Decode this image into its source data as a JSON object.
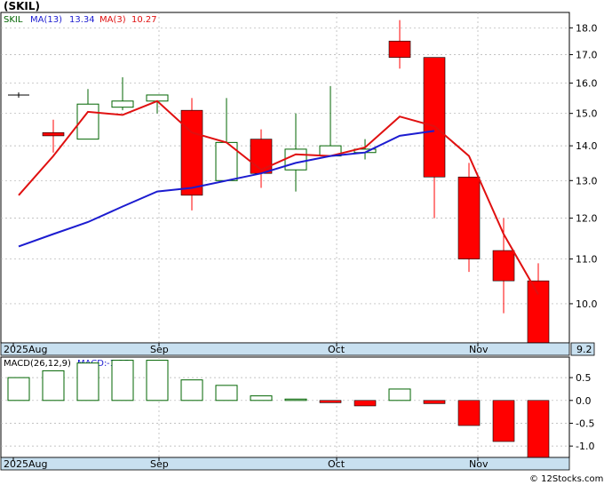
{
  "chart_title": "(SKIL)",
  "watermark": "© 12Stocks.com",
  "colors": {
    "up": "#006400",
    "down": "#ff0000",
    "ma13": "#1c1cd0",
    "ma3": "#e01010",
    "grid": "#b0b0b0",
    "axis_band": "#c8e0f0",
    "price_box": "#c8e0f0"
  },
  "price_panel": {
    "legend": [
      {
        "key": "symbol",
        "text": "SKIL",
        "color": "#006400"
      },
      {
        "key": "ma13",
        "text": "MA(13)",
        "value": "13.34",
        "color": "#1c1cd0"
      },
      {
        "key": "ma3",
        "text": "MA(3)",
        "value": "10.27",
        "color": "#e01010"
      }
    ],
    "last_price_label": "9.2",
    "y_ticks": [
      "10.0",
      "11.0",
      "12.0",
      "13.0",
      "14.0",
      "15.0",
      "16.0",
      "17.0",
      "18.0"
    ],
    "x_labels": [
      "2025Aug",
      "Sep",
      "Oct",
      "Nov"
    ]
  },
  "macd_panel": {
    "legend_main": "MACD(26,12,9)",
    "legend_value_label": "MACD:",
    "legend_value": "-1.25",
    "y_ticks": [
      "0.5",
      "0.0",
      "-0.5",
      "-1.0"
    ],
    "x_labels": [
      "2025Aug",
      "Sep",
      "Oct",
      "Nov"
    ]
  },
  "chart_data": [
    {
      "type": "candlestick",
      "title": "(SKIL)",
      "ylim": [
        9.2,
        18.6
      ],
      "y_scale": "log",
      "candles": [
        {
          "open": 15.6,
          "high": 15.6,
          "low": 15.6,
          "close": 15.6
        },
        {
          "open": 14.4,
          "high": 14.8,
          "low": 13.8,
          "close": 14.3
        },
        {
          "open": 14.2,
          "high": 15.8,
          "low": 14.2,
          "close": 15.3
        },
        {
          "open": 15.2,
          "high": 16.2,
          "low": 15.1,
          "close": 15.4
        },
        {
          "open": 15.4,
          "high": 15.6,
          "low": 15.0,
          "close": 15.6
        },
        {
          "open": 15.1,
          "high": 15.5,
          "low": 12.2,
          "close": 12.6
        },
        {
          "open": 13.0,
          "high": 15.5,
          "low": 13.0,
          "close": 14.1
        },
        {
          "open": 14.2,
          "high": 14.5,
          "low": 12.8,
          "close": 13.2
        },
        {
          "open": 13.3,
          "high": 15.0,
          "low": 12.7,
          "close": 13.9
        },
        {
          "open": 13.7,
          "high": 15.9,
          "low": 13.7,
          "close": 14.0
        },
        {
          "open": 13.8,
          "high": 14.2,
          "low": 13.6,
          "close": 13.9
        },
        {
          "open": 17.5,
          "high": 18.3,
          "low": 16.5,
          "close": 16.9
        },
        {
          "open": 16.9,
          "high": 16.9,
          "low": 12.0,
          "close": 13.1
        },
        {
          "open": 13.1,
          "high": 13.5,
          "low": 10.7,
          "close": 11.0
        },
        {
          "open": 11.2,
          "high": 12.0,
          "low": 9.8,
          "close": 10.5
        },
        {
          "open": 10.5,
          "high": 10.9,
          "low": 9.2,
          "close": 9.2
        }
      ],
      "ma13": [
        null,
        null,
        null,
        null,
        null,
        null,
        null,
        null,
        null,
        null,
        null,
        null,
        null,
        null,
        null,
        null
      ],
      "ma13_points": [
        {
          "i": 0,
          "v": 11.3
        },
        {
          "i": 2,
          "v": 11.6
        },
        {
          "i": 4,
          "v": 11.9
        },
        {
          "i": 6,
          "v": 12.3
        },
        {
          "i": 8,
          "v": 12.7
        },
        {
          "i": 10,
          "v": 12.8
        },
        {
          "i": 12,
          "v": 13.0
        },
        {
          "i": 14,
          "v": 13.2
        },
        {
          "i": 16,
          "v": 13.5
        },
        {
          "i": 18,
          "v": 13.7
        },
        {
          "i": 20,
          "v": 13.8
        },
        {
          "i": 22,
          "v": 14.3
        },
        {
          "i": 24,
          "v": 14.45
        }
      ],
      "ma3_points": [
        {
          "i": 0,
          "v": 12.6
        },
        {
          "i": 2,
          "v": 13.7
        },
        {
          "i": 4,
          "v": 15.05
        },
        {
          "i": 6,
          "v": 14.95
        },
        {
          "i": 8,
          "v": 15.4
        },
        {
          "i": 10,
          "v": 14.4
        },
        {
          "i": 12,
          "v": 14.1
        },
        {
          "i": 14,
          "v": 13.3
        },
        {
          "i": 16,
          "v": 13.75
        },
        {
          "i": 18,
          "v": 13.7
        },
        {
          "i": 20,
          "v": 13.95
        },
        {
          "i": 22,
          "v": 14.9
        },
        {
          "i": 24,
          "v": 14.6
        },
        {
          "i": 26,
          "v": 13.7
        },
        {
          "i": 28,
          "v": 11.6
        },
        {
          "i": 30,
          "v": 10.2
        }
      ]
    },
    {
      "type": "bar",
      "title": "MACD(26,12,9)",
      "ylim": [
        -1.25,
        0.95
      ],
      "values": [
        0.5,
        0.65,
        0.82,
        0.88,
        0.88,
        0.45,
        0.33,
        0.1,
        0.03,
        -0.05,
        -0.12,
        0.25,
        -0.07,
        -0.55,
        -0.9,
        -1.25
      ]
    }
  ]
}
